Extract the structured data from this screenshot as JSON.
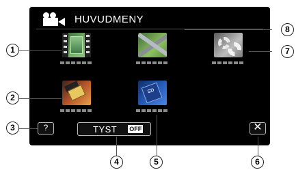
{
  "header": {
    "title": "HUVUDMENY",
    "icon": "movie-camera-icon"
  },
  "tiles": [
    {
      "name": "video-playback-icon",
      "label": "▮▮▮▮▮▮"
    },
    {
      "name": "edit-icon",
      "label": "▮▮▮▮▮▮"
    },
    {
      "name": "settings-gear-icon",
      "label": "▮▮▮▮▮▮"
    },
    {
      "name": "copy-icon",
      "label": "▮▮▮▮▮▮"
    },
    {
      "name": "sd-card-icon",
      "label": "▮▮▮▮▮▮"
    }
  ],
  "footer": {
    "help_label": "?",
    "mute_label": "TYST",
    "mute_state": "OFF",
    "close_label": "✕"
  },
  "callouts": [
    "1",
    "2",
    "3",
    "4",
    "5",
    "6",
    "7",
    "8"
  ],
  "colors": {
    "screen_bg": "#000000",
    "dot_gray": "#8a8a8a",
    "page_bg": "#ffffff"
  }
}
